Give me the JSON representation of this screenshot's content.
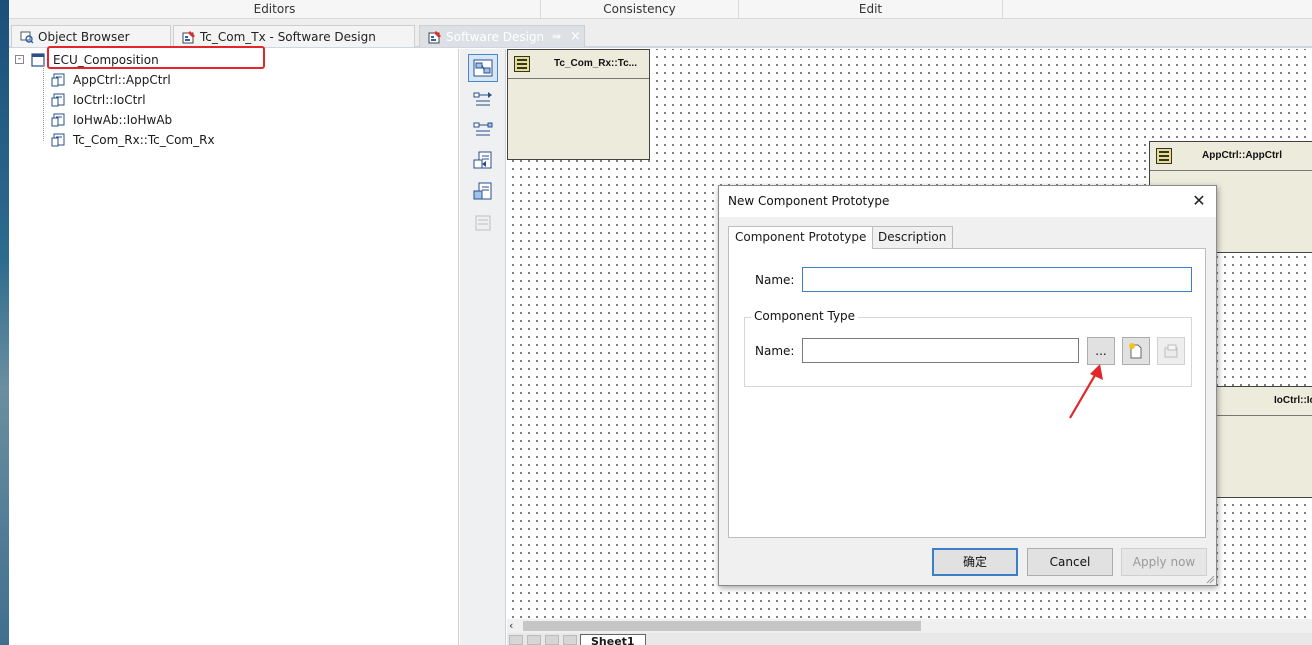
{
  "ribbon": {
    "groups": [
      "Editors",
      "Consistency",
      "Edit"
    ]
  },
  "tabs": {
    "object_browser": "Object Browser",
    "tc_com_tx": "Tc_Com_Tx - Software Design",
    "software_design": "Software Design",
    "pin_glyph": "⇛",
    "close_glyph": "×"
  },
  "tree": {
    "root": {
      "label": "ECU_Composition",
      "expander": "-"
    },
    "children": [
      "AppCtrl::AppCtrl",
      "IoCtrl::IoCtrl",
      "IoHwAb::IoHwAb",
      "Tc_Com_Rx::Tc_Com_Rx"
    ]
  },
  "canvas": {
    "components": [
      {
        "title": "Tc_Com_Rx::Tc..."
      },
      {
        "title": "AppCtrl::AppCtrl"
      },
      {
        "title": "IoCtrl::Io"
      }
    ],
    "sheet_tab": "Sheet1",
    "scroll_left_glyph": "‹"
  },
  "dialog": {
    "title": "New Component Prototype",
    "close_glyph": "✕",
    "tabs": [
      "Component Prototype",
      "Description"
    ],
    "prototype_name_label": "Name:",
    "prototype_name_value": "",
    "component_type_legend": "Component Type",
    "type_name_label": "Name:",
    "type_name_value": "",
    "browse_label": "...",
    "ok_label": "确定",
    "cancel_label": "Cancel",
    "apply_label": "Apply now"
  },
  "colors": {
    "highlight_red": "#e3262a",
    "accent_blue": "#3b7fc4",
    "component_fill": "#ecebdc"
  }
}
